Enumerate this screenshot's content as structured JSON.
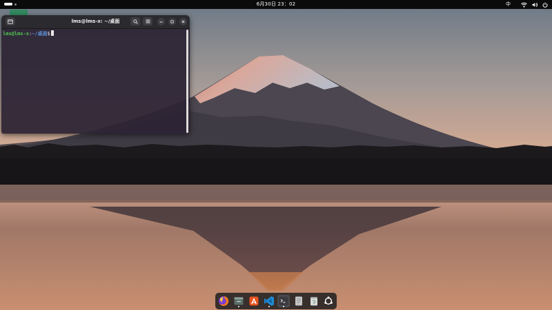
{
  "topbar": {
    "clock": "6月30日  23：02",
    "input_method": "中"
  },
  "terminal": {
    "title": "lms@lms-x: ~/桌面",
    "prompt_user": "lms@lms-x",
    "prompt_sep": ":",
    "prompt_path": "~/桌面",
    "prompt_symbol": "$"
  },
  "dock": {
    "items": [
      {
        "name": "firefox-icon",
        "running": false
      },
      {
        "name": "files-icon",
        "running": true
      },
      {
        "name": "software-store-icon",
        "running": false
      },
      {
        "name": "vscode-icon",
        "running": true
      },
      {
        "name": "terminal-icon",
        "running": true
      },
      {
        "name": "text-editor-icon",
        "running": false
      },
      {
        "name": "trash-icon",
        "running": false
      },
      {
        "name": "show-apps-icon",
        "running": false
      }
    ]
  },
  "colors": {
    "prompt_user": "#4ec94e",
    "prompt_path": "#5b8fd6",
    "topbar_bg": "#0b0b0b"
  }
}
